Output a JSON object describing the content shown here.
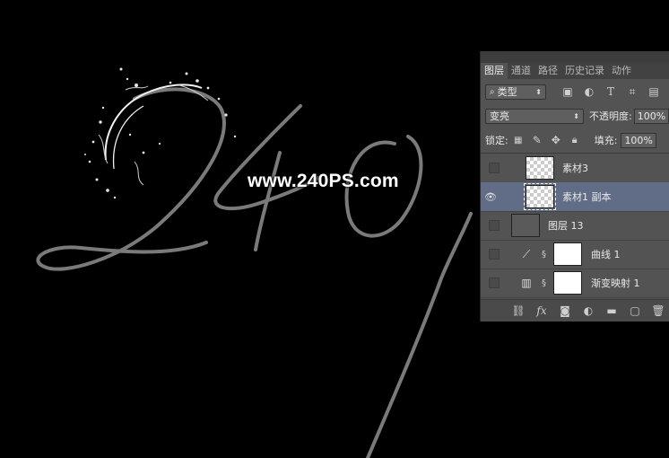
{
  "watermark": "www.240PS.com",
  "panel": {
    "tabs": [
      {
        "label": "图层",
        "active": true
      },
      {
        "label": "通道",
        "active": false
      },
      {
        "label": "路径",
        "active": false
      },
      {
        "label": "历史记录",
        "active": false
      },
      {
        "label": "动作",
        "active": false
      }
    ],
    "filter": {
      "icon": "search-icon",
      "label": "类型"
    },
    "filter_icons": [
      "image-filter-icon",
      "adjustment-filter-icon",
      "text-filter-icon",
      "shape-filter-icon",
      "smart-object-filter-icon"
    ],
    "blend_mode": "变亮",
    "opacity_label": "不透明度:",
    "opacity_value": "100%",
    "lock_label": "锁定:",
    "lock_icons": [
      "lock-transparency-icon",
      "lock-paint-icon",
      "lock-position-icon",
      "lock-all-icon"
    ],
    "fill_label": "填充:",
    "fill_value": "100%",
    "layers": [
      {
        "name": "素材3",
        "visible": false,
        "selected": false,
        "thumb": "transparent"
      },
      {
        "name": "素材1 副本",
        "visible": true,
        "selected": true,
        "thumb": "transparent"
      },
      {
        "name": "图层 13",
        "visible": false,
        "selected": false,
        "thumb": "grey"
      },
      {
        "name": "曲线 1",
        "visible": false,
        "selected": false,
        "thumb": "white",
        "adjustment": "curves-icon"
      },
      {
        "name": "渐变映射 1",
        "visible": false,
        "selected": false,
        "thumb": "white",
        "adjustment": "gradient-map-icon"
      }
    ],
    "footer_icons": [
      "link-icon",
      "fx-icon",
      "mask-icon",
      "adjustment-layer-icon",
      "folder-icon",
      "new-layer-icon",
      "trash-icon"
    ]
  }
}
